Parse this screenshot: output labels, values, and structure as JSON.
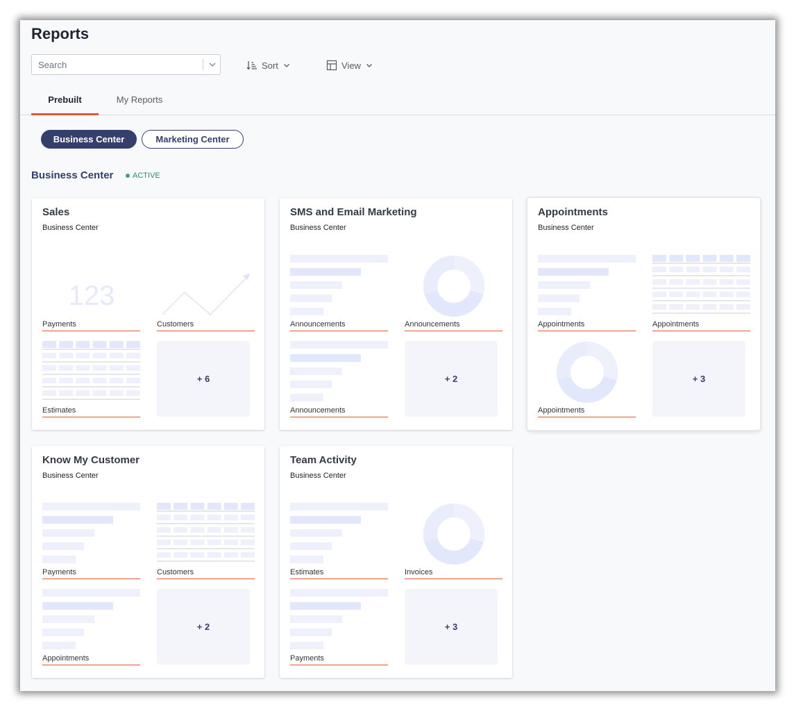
{
  "page": {
    "title": "Reports"
  },
  "toolbar": {
    "search_placeholder": "Search",
    "sort_label": "Sort",
    "view_label": "View"
  },
  "tabs": [
    {
      "label": "Prebuilt",
      "active": true
    },
    {
      "label": "My Reports",
      "active": false
    }
  ],
  "filters": [
    {
      "label": "Business Center",
      "active": true
    },
    {
      "label": "Marketing Center",
      "active": false
    }
  ],
  "section": {
    "title": "Business Center",
    "status": "ACTIVE",
    "status_color": "#3ea272"
  },
  "colors": {
    "accent_line": "#e5582e",
    "primary": "#34406b",
    "placeholder_fill": "#e3e7fb"
  },
  "cards": [
    {
      "title": "Sales",
      "subtitle": "Business Center",
      "cells": [
        {
          "type": "number",
          "label": "Payments",
          "value": "123"
        },
        {
          "type": "line",
          "label": "Customers"
        },
        {
          "type": "table",
          "label": "Estimates"
        },
        {
          "type": "more",
          "label": "+ 6"
        }
      ]
    },
    {
      "title": "SMS and Email Marketing",
      "subtitle": "Business Center",
      "cells": [
        {
          "type": "bars",
          "label": "Announcements"
        },
        {
          "type": "donut",
          "label": "Announcements"
        },
        {
          "type": "bars",
          "label": "Announcements"
        },
        {
          "type": "more",
          "label": "+ 2"
        }
      ]
    },
    {
      "title": "Appointments",
      "subtitle": "Business Center",
      "cells": [
        {
          "type": "bars",
          "label": "Appointments"
        },
        {
          "type": "table",
          "label": "Appointments"
        },
        {
          "type": "donut",
          "label": "Appointments"
        },
        {
          "type": "more",
          "label": "+ 3"
        }
      ]
    },
    {
      "title": "Know My Customer",
      "subtitle": "Business Center",
      "cells": [
        {
          "type": "bars",
          "label": "Payments"
        },
        {
          "type": "table",
          "label": "Customers"
        },
        {
          "type": "bars",
          "label": "Appointments"
        },
        {
          "type": "more",
          "label": "+ 2"
        }
      ]
    },
    {
      "title": "Team Activity",
      "subtitle": "Business Center",
      "cells": [
        {
          "type": "bars",
          "label": "Estimates"
        },
        {
          "type": "donut",
          "label": "Invoices"
        },
        {
          "type": "bars",
          "label": "Payments"
        },
        {
          "type": "more",
          "label": "+ 3"
        }
      ]
    }
  ]
}
